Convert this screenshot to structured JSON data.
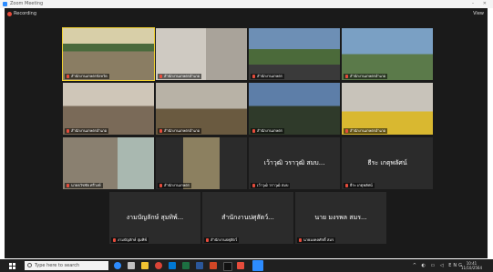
{
  "window": {
    "title": "Zoom Meeting"
  },
  "meeting": {
    "recording_label": "Recording",
    "view_label": "View",
    "tiles": [
      {
        "name": "สำนักงานเกษตรจังหวัด",
        "display": "",
        "video": true,
        "active": true
      },
      {
        "name": "สำนักงานเกษตรอำเภอ",
        "display": "",
        "video": true
      },
      {
        "name": "สำนักงานเกษตร",
        "display": "",
        "video": true
      },
      {
        "name": "สำนักงานเกษตรอำเภอ",
        "display": "",
        "video": true
      },
      {
        "name": "สำนักงานเกษตรอำเภอ",
        "display": "",
        "video": true
      },
      {
        "name": "สำนักงานเกษตรอำเภอ",
        "display": "",
        "video": true
      },
      {
        "name": "สำนักงานเกษตร",
        "display": "",
        "video": true
      },
      {
        "name": "สำนักงานเกษตรอำเภอ",
        "display": "",
        "video": true
      },
      {
        "name": "นายธวัชชัย ศรีวงษ์",
        "display": "",
        "video": true
      },
      {
        "name": "สำนักงานเกษตร",
        "display": "",
        "video": true
      },
      {
        "name": "เว้าวุฒิ วราวุฒิ สมบ",
        "display": "เว้าวุฒิ วราวุฒิ สมบ...",
        "video": false
      },
      {
        "name": "ธีระ เกตุพลัศน์",
        "display": "ธีระ เกตุพลัศน์",
        "video": false
      },
      {
        "name": "งามบัญลักษ์ สุมทิพ์",
        "display": "งามบัญลักษ์ สุมทิพ์...",
        "video": false
      },
      {
        "name": "สำนักงานปศุสัตว์",
        "display": "สำนักงานปศุสัตว์...",
        "video": false
      },
      {
        "name": "นายมงคลศักดิ์ สมร",
        "display": "นาย มงรพล สมร...",
        "video": false
      }
    ]
  },
  "taskbar": {
    "search_placeholder": "Type here to search",
    "tray_icons": "^ ◐ ▭ ◁ ENG",
    "time": "10:41",
    "date": "11/10/2564"
  },
  "colors": {
    "accent": "#2d8cff",
    "active_speaker": "#f2d230",
    "recording": "#e74c3c"
  }
}
